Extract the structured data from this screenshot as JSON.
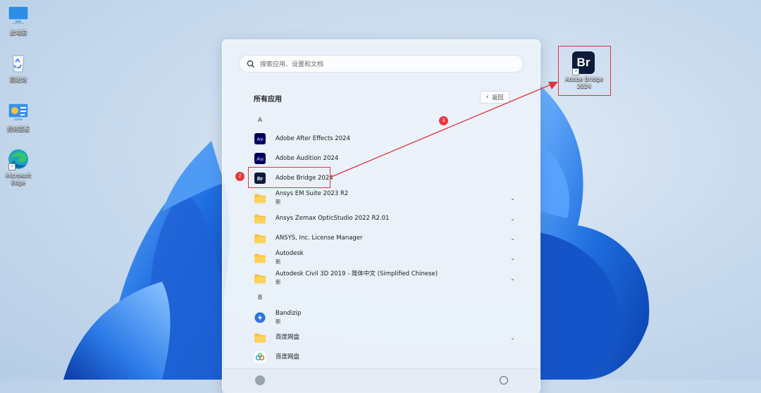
{
  "desktop": {
    "icons": [
      {
        "label": "此电脑",
        "icon": "computer-icon"
      },
      {
        "label": "回收站",
        "icon": "recycle-bin-icon"
      },
      {
        "label": "控制面板",
        "icon": "control-panel-icon"
      },
      {
        "label": "Microsoft Edge",
        "icon": "edge-icon"
      }
    ],
    "bridge_shortcut": {
      "label": "Adobe Bridge 2024",
      "glyph": "Br"
    }
  },
  "start_menu": {
    "search_placeholder": "搜索应用、设置和文档",
    "title": "所有应用",
    "back_label": "返回",
    "sections": [
      {
        "letter": "A"
      },
      {
        "letter": "B"
      }
    ],
    "apps": [
      {
        "name": "Adobe After Effects 2024",
        "glyph": "Ae",
        "color": "#00005b",
        "accent": "#9999ff"
      },
      {
        "name": "Adobe Audition 2024",
        "glyph": "Au",
        "color": "#00005b",
        "accent": "#9999ff"
      },
      {
        "name": "Adobe Bridge 2024",
        "glyph": "Br",
        "color": "#0e1a3a",
        "accent": "#ffffff"
      },
      {
        "name": "Ansys EM Suite 2023 R2",
        "sub": "新",
        "icon": "folder-icon"
      },
      {
        "name": "Ansys Zemax OpticStudio 2022 R2.01",
        "icon": "folder-icon"
      },
      {
        "name": "ANSYS, Inc. License Manager",
        "icon": "folder-icon"
      },
      {
        "name": "Autodesk",
        "sub": "新",
        "icon": "folder-icon"
      },
      {
        "name": "Autodesk Civil 3D 2019 - 简体中文 (Simplified Chinese)",
        "sub": "新",
        "icon": "folder-icon"
      },
      {
        "name": "Bandizip",
        "sub": "新",
        "icon": "bandizip-icon"
      },
      {
        "name": "百度网盘",
        "icon": "folder-icon"
      },
      {
        "name": "百度网盘",
        "icon": "baidu-netdisk-icon"
      }
    ]
  },
  "annotations": {
    "step2": "2",
    "step3": "3",
    "color": "#e0343f"
  }
}
